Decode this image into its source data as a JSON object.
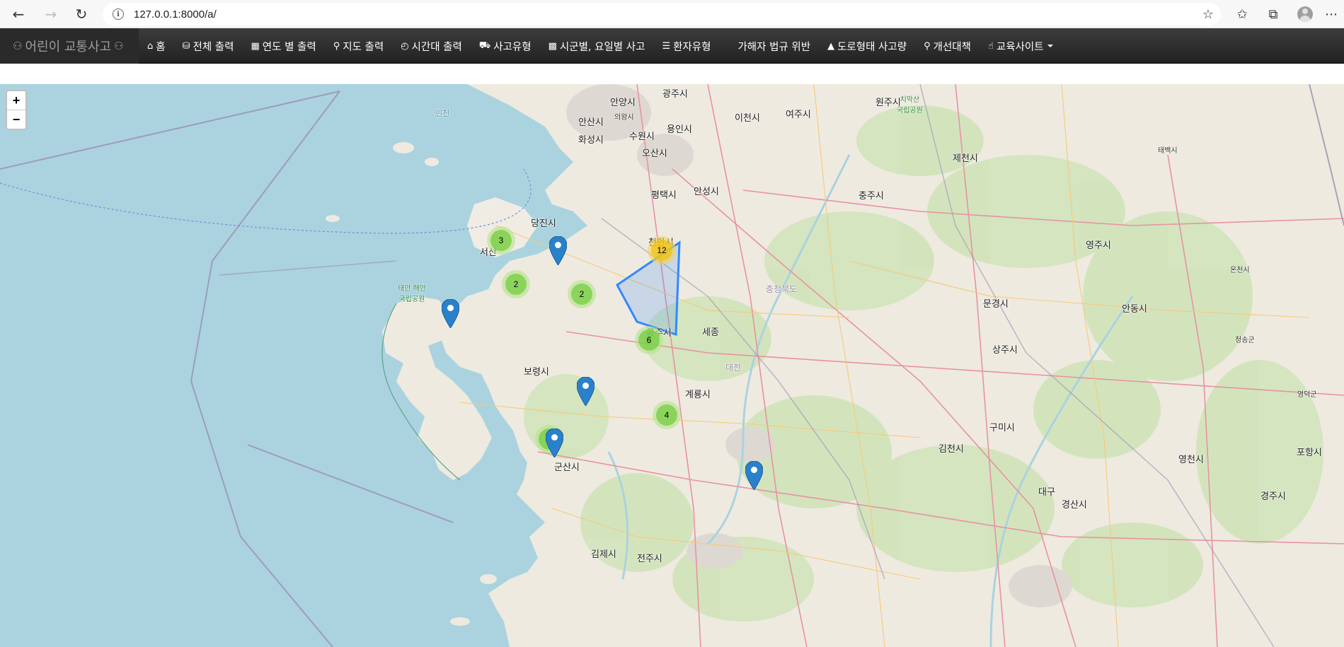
{
  "browser": {
    "url": "127.0.0.1:8000/a/"
  },
  "navbar": {
    "brand": "어린이 교통사고",
    "items": [
      {
        "label": "홈",
        "icon": "home-icon"
      },
      {
        "label": "전체 출력",
        "icon": "database-icon"
      },
      {
        "label": "연도 별 출력",
        "icon": "calendar-icon"
      },
      {
        "label": "지도 출력",
        "icon": "map-marker-icon"
      },
      {
        "label": "시간대 출력",
        "icon": "clock-icon"
      },
      {
        "label": "사고유형",
        "icon": "car-icon"
      },
      {
        "label": "시군별, 요일별 사고",
        "icon": "bar-chart-icon"
      },
      {
        "label": "환자유형",
        "icon": "clipboard-icon"
      },
      {
        "label": "가해자 법규 위반",
        "icon": ""
      },
      {
        "label": "도로형태 사고량",
        "icon": "road-icon"
      },
      {
        "label": "개선대책",
        "icon": "lightbulb-icon"
      },
      {
        "label": "교육사이트",
        "icon": "thumbs-up-icon"
      }
    ]
  },
  "map": {
    "zoom_in": "+",
    "zoom_out": "−",
    "clusters": [
      "3",
      "2",
      "2",
      "12",
      "6",
      "4",
      "2"
    ],
    "places": {
      "incheon": "인천",
      "seoul_gwangju": "광주시",
      "anyang": "안양시",
      "uiwang": "의왕시",
      "ansan": "안산시",
      "suwon": "수원시",
      "yongin": "용인시",
      "hwaseong": "화성시",
      "osan": "오산시",
      "pyeongtaek": "평택시",
      "anseong": "안성시",
      "icheon": "이천시",
      "yeoju": "여주시",
      "wonju": "원주시",
      "jecheon": "제천시",
      "chungju": "충주시",
      "yeongju": "영주시",
      "andong": "안동시",
      "sangju": "상주시",
      "mungyeong": "문경시",
      "gumi": "구미시",
      "daegu": "대구",
      "gyeongsan": "경산시",
      "gyeongju": "경주시",
      "pohang": "포항시",
      "yeongcheon": "영천시",
      "gimcheon": "김천시",
      "dangjin": "당진시",
      "seosan": "서산",
      "boryeong": "보령시",
      "gongju": "공주시",
      "sejong": "세종",
      "gunsan": "군산시",
      "gimje": "김제시",
      "jeonju": "전주시",
      "cheonan": "천안시",
      "gyeryong": "계룡시",
      "taean_park": "태안 해안\n국립공원",
      "chiak_park": "치악산\n국립공원",
      "chungbuk": "충청북도",
      "daejeon": "대전",
      "oncheon": "온천시",
      "yeongdeok": "영덕군",
      "cheongsong": "청송군",
      "taebaek": "태백시"
    }
  }
}
